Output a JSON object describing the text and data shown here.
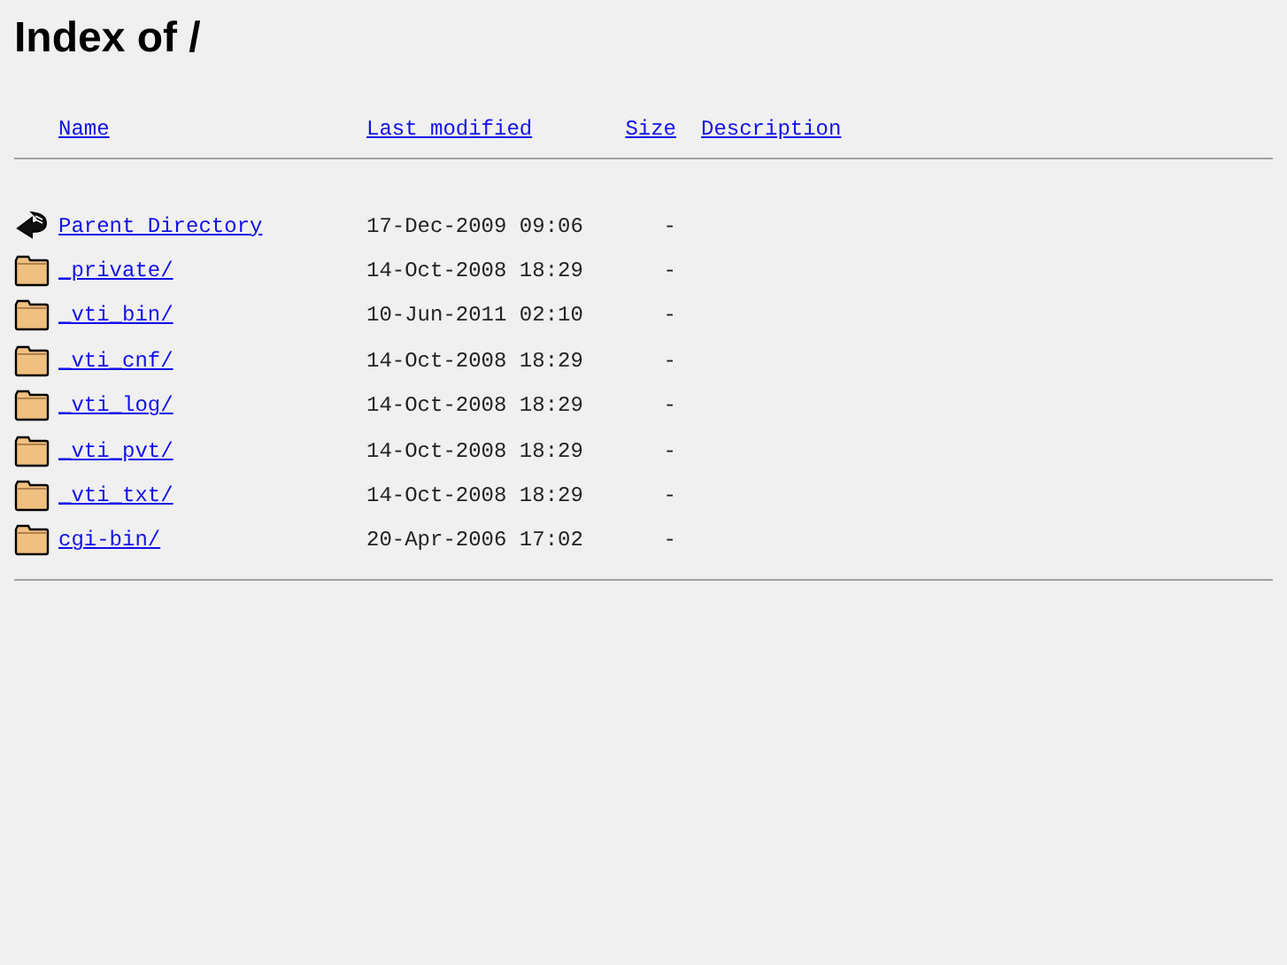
{
  "title": "Index of /",
  "columns": [
    "Name",
    "Last modified",
    "Size",
    "Description"
  ],
  "rows": [
    {
      "kind": "parent",
      "name": "Parent Directory",
      "modified": "17-Dec-2009 09:06",
      "size": "-"
    },
    {
      "kind": "folder",
      "name": "_private/",
      "modified": "14-Oct-2008 18:29",
      "size": "-"
    },
    {
      "kind": "folder",
      "name": "_vti_bin/",
      "modified": "10-Jun-2011 02:10",
      "size": "-"
    },
    {
      "kind": "folder",
      "name": "_vti_cnf/",
      "modified": "14-Oct-2008 18:29",
      "size": "-"
    },
    {
      "kind": "folder",
      "name": "_vti_log/",
      "modified": "14-Oct-2008 18:29",
      "size": "-"
    },
    {
      "kind": "folder",
      "name": "_vti_pvt/",
      "modified": "14-Oct-2008 18:29",
      "size": "-"
    },
    {
      "kind": "folder",
      "name": "_vti_txt/",
      "modified": "14-Oct-2008 18:29",
      "size": "-"
    },
    {
      "kind": "folder",
      "name": "cgi-bin/",
      "modified": "20-Apr-2006 17:02",
      "size": "-"
    }
  ]
}
